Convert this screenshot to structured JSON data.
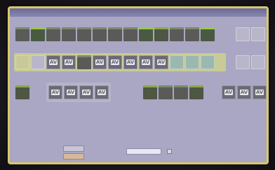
{
  "window": {
    "title": ""
  },
  "icons": {
    "av_label": "AV"
  },
  "bottom": {
    "button1_label": "",
    "button2_label": "",
    "field_label": "",
    "spin_value": "",
    "check_label": ""
  }
}
